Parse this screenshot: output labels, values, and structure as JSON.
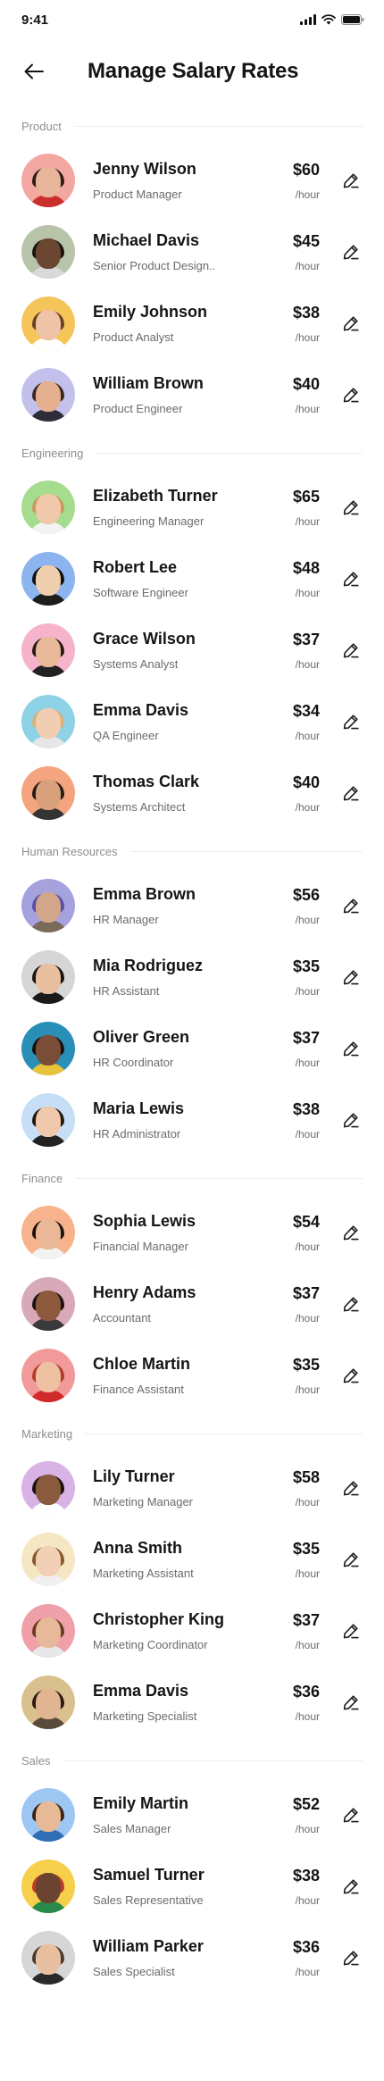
{
  "status_bar": {
    "time": "9:41"
  },
  "header": {
    "title": "Manage Salary Rates"
  },
  "sections": [
    {
      "title": "Product",
      "people": [
        {
          "name": "Jenny Wilson",
          "role": "Product Manager",
          "rate": "$60",
          "unit": "/hour",
          "bg": "#f2a7a0",
          "hair": "#2b1d16",
          "skin": "#e9b59a",
          "shirt": "#c9302c"
        },
        {
          "name": "Michael Davis",
          "role": "Senior Product Design..",
          "rate": "$45",
          "unit": "/hour",
          "bg": "#b8c4a9",
          "hair": "#1a1410",
          "skin": "#6b4630",
          "shirt": "#d9d9d9"
        },
        {
          "name": "Emily Johnson",
          "role": "Product Analyst",
          "rate": "$38",
          "unit": "/hour",
          "bg": "#f5c55a",
          "hair": "#6b3f22",
          "skin": "#eec3a6",
          "shirt": "#ffffff"
        },
        {
          "name": "William Brown",
          "role": "Product Engineer",
          "rate": "$40",
          "unit": "/hour",
          "bg": "#c4c0ec",
          "hair": "#3a2a22",
          "skin": "#e4b08f",
          "shirt": "#2d2d3a"
        }
      ]
    },
    {
      "title": "Engineering",
      "people": [
        {
          "name": "Elizabeth Turner",
          "role": "Engineering Manager",
          "rate": "$65",
          "unit": "/hour",
          "bg": "#a6dc8e",
          "hair": "#c99a5c",
          "skin": "#f0c9ad",
          "shirt": "#f3f3f3"
        },
        {
          "name": "Robert Lee",
          "role": "Software Engineer",
          "rate": "$48",
          "unit": "/hour",
          "bg": "#8cb4ee",
          "hair": "#111111",
          "skin": "#f0cfae",
          "shirt": "#1d1d1d"
        },
        {
          "name": "Grace Wilson",
          "role": "Systems Analyst",
          "rate": "$37",
          "unit": "/hour",
          "bg": "#f6b3cc",
          "hair": "#2a1b14",
          "skin": "#e8b999",
          "shirt": "#222222"
        },
        {
          "name": "Emma Davis",
          "role": "QA Engineer",
          "rate": "$34",
          "unit": "/hour",
          "bg": "#8dd2e6",
          "hair": "#d9b27a",
          "skin": "#f1cdb2",
          "shirt": "#e6e6e6"
        },
        {
          "name": "Thomas Clark",
          "role": "Systems Architect",
          "rate": "$40",
          "unit": "/hour",
          "bg": "#f4a47f",
          "hair": "#2a1b14",
          "skin": "#d9a07c",
          "shirt": "#333333"
        }
      ]
    },
    {
      "title": "Human Resources",
      "people": [
        {
          "name": "Emma Brown",
          "role": "HR Manager",
          "rate": "$56",
          "unit": "/hour",
          "bg": "#a6a2de",
          "hair": "#5a4fa6",
          "skin": "#d2a68a",
          "shirt": "#7a6a5a"
        },
        {
          "name": "Mia Rodriguez",
          "role": "HR Assistant",
          "rate": "$35",
          "unit": "/hour",
          "bg": "#d6d6d6",
          "hair": "#1c1410",
          "skin": "#eabf9f",
          "shirt": "#1a1a1a"
        },
        {
          "name": "Oliver Green",
          "role": "HR Coordinator",
          "rate": "$37",
          "unit": "/hour",
          "bg": "#2a8fb6",
          "hair": "#161010",
          "skin": "#7a4e36",
          "shirt": "#e8c23a"
        },
        {
          "name": "Maria Lewis",
          "role": "HR Administrator",
          "rate": "$38",
          "unit": "/hour",
          "bg": "#c7dff6",
          "hair": "#24180f",
          "skin": "#f0c8ab",
          "shirt": "#222222"
        }
      ]
    },
    {
      "title": "Finance",
      "people": [
        {
          "name": "Sophia Lewis",
          "role": "Financial Manager",
          "rate": "$54",
          "unit": "/hour",
          "bg": "#f7b38c",
          "hair": "#1e140f",
          "skin": "#eab896",
          "shirt": "#f2f2f2"
        },
        {
          "name": "Henry Adams",
          "role": "Accountant",
          "rate": "$37",
          "unit": "/hour",
          "bg": "#d8a9b6",
          "hair": "#1a120e",
          "skin": "#8e5a3e",
          "shirt": "#3a3a3a"
        },
        {
          "name": "Chloe Martin",
          "role": "Finance Assistant",
          "rate": "$35",
          "unit": "/hour",
          "bg": "#f29a9a",
          "hair": "#b53a2a",
          "skin": "#eec1a3",
          "shirt": "#d02a2a"
        }
      ]
    },
    {
      "title": "Marketing",
      "people": [
        {
          "name": "Lily Turner",
          "role": "Marketing Manager",
          "rate": "$58",
          "unit": "/hour",
          "bg": "#d9b3e6",
          "hair": "#1a120e",
          "skin": "#8a5a3e",
          "shirt": "#ffffff"
        },
        {
          "name": "Anna Smith",
          "role": "Marketing Assistant",
          "rate": "$35",
          "unit": "/hour",
          "bg": "#f6e7c3",
          "hair": "#8a5a2e",
          "skin": "#f2d0b6",
          "shirt": "#f0f0f0"
        },
        {
          "name": "Christopher King",
          "role": "Marketing Coordinator",
          "rate": "$37",
          "unit": "/hour",
          "bg": "#f0a0a8",
          "hair": "#6a3a22",
          "skin": "#e8b89a",
          "shirt": "#e8e8e8"
        },
        {
          "name": "Emma Davis",
          "role": "Marketing Specialist",
          "rate": "$36",
          "unit": "/hour",
          "bg": "#d9c08e",
          "hair": "#2a1a12",
          "skin": "#e2b592",
          "shirt": "#5a4a3a"
        }
      ]
    },
    {
      "title": "Sales",
      "people": [
        {
          "name": "Emily Martin",
          "role": "Sales Manager",
          "rate": "$52",
          "unit": "/hour",
          "bg": "#9ec6f2",
          "hair": "#3a2418",
          "skin": "#e8b996",
          "shirt": "#2e6fb6"
        },
        {
          "name": "Samuel Turner",
          "role": "Sales Representative",
          "rate": "$38",
          "unit": "/hour",
          "bg": "#f6d04a",
          "hair": "#c03a2a",
          "skin": "#6a4430",
          "shirt": "#2a8a4a"
        },
        {
          "name": "William Parker",
          "role": "Sales Specialist",
          "rate": "$36",
          "unit": "/hour",
          "bg": "#d6d6d6",
          "hair": "#4a3a30",
          "skin": "#e8c0a0",
          "shirt": "#2a2a2a"
        }
      ]
    }
  ],
  "icons": {
    "back": "arrow-left-icon",
    "edit": "pencil-edit-icon"
  }
}
